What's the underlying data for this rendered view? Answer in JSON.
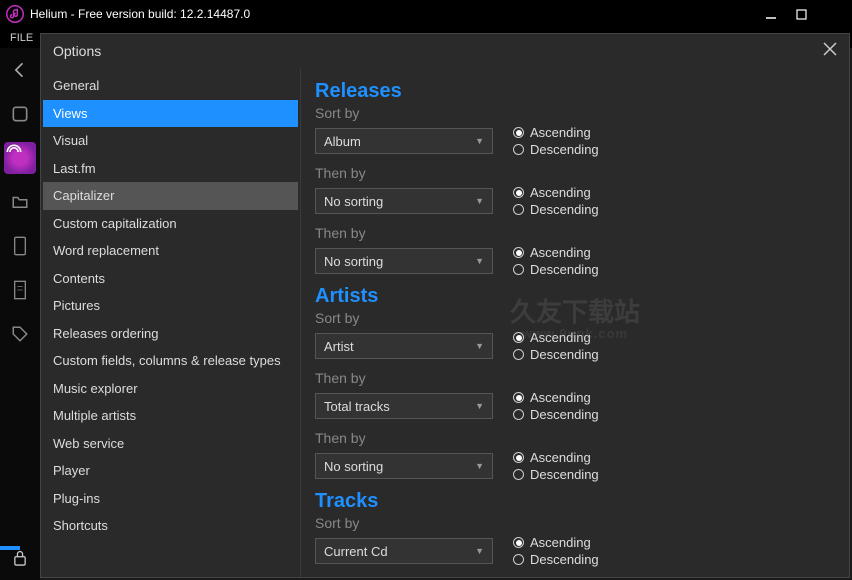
{
  "window": {
    "title": "Helium - Free version build: 12.2.14487.0",
    "menubar_file": "FILE"
  },
  "dialog": {
    "title": "Options",
    "nav": [
      "General",
      "Views",
      "Visual",
      "Last.fm",
      "Capitalizer",
      "Custom capitalization",
      "Word replacement",
      "Contents",
      "Pictures",
      "Releases ordering",
      "Custom fields, columns & release types",
      "Music explorer",
      "Multiple artists",
      "Web service",
      "Player",
      "Plug-ins",
      "Shortcuts"
    ],
    "selected_nav_index": 1,
    "hovered_nav_index": 4
  },
  "labels": {
    "sort_by": "Sort by",
    "then_by": "Then by",
    "ascending": "Ascending",
    "descending": "Descending"
  },
  "sections": [
    {
      "title": "Releases",
      "rows": [
        {
          "dropdown": "Album",
          "dir": "asc"
        },
        {
          "dropdown": "No sorting",
          "dir": "asc"
        },
        {
          "dropdown": "No sorting",
          "dir": "asc"
        }
      ]
    },
    {
      "title": "Artists",
      "rows": [
        {
          "dropdown": "Artist",
          "dir": "asc"
        },
        {
          "dropdown": "Total tracks",
          "dir": "asc"
        },
        {
          "dropdown": "No sorting",
          "dir": "asc"
        }
      ]
    },
    {
      "title": "Tracks",
      "rows": [
        {
          "dropdown": "Current Cd",
          "dir": "asc"
        }
      ]
    }
  ],
  "watermark": {
    "main": "久友下载站",
    "sub": "www.9upk.com"
  }
}
